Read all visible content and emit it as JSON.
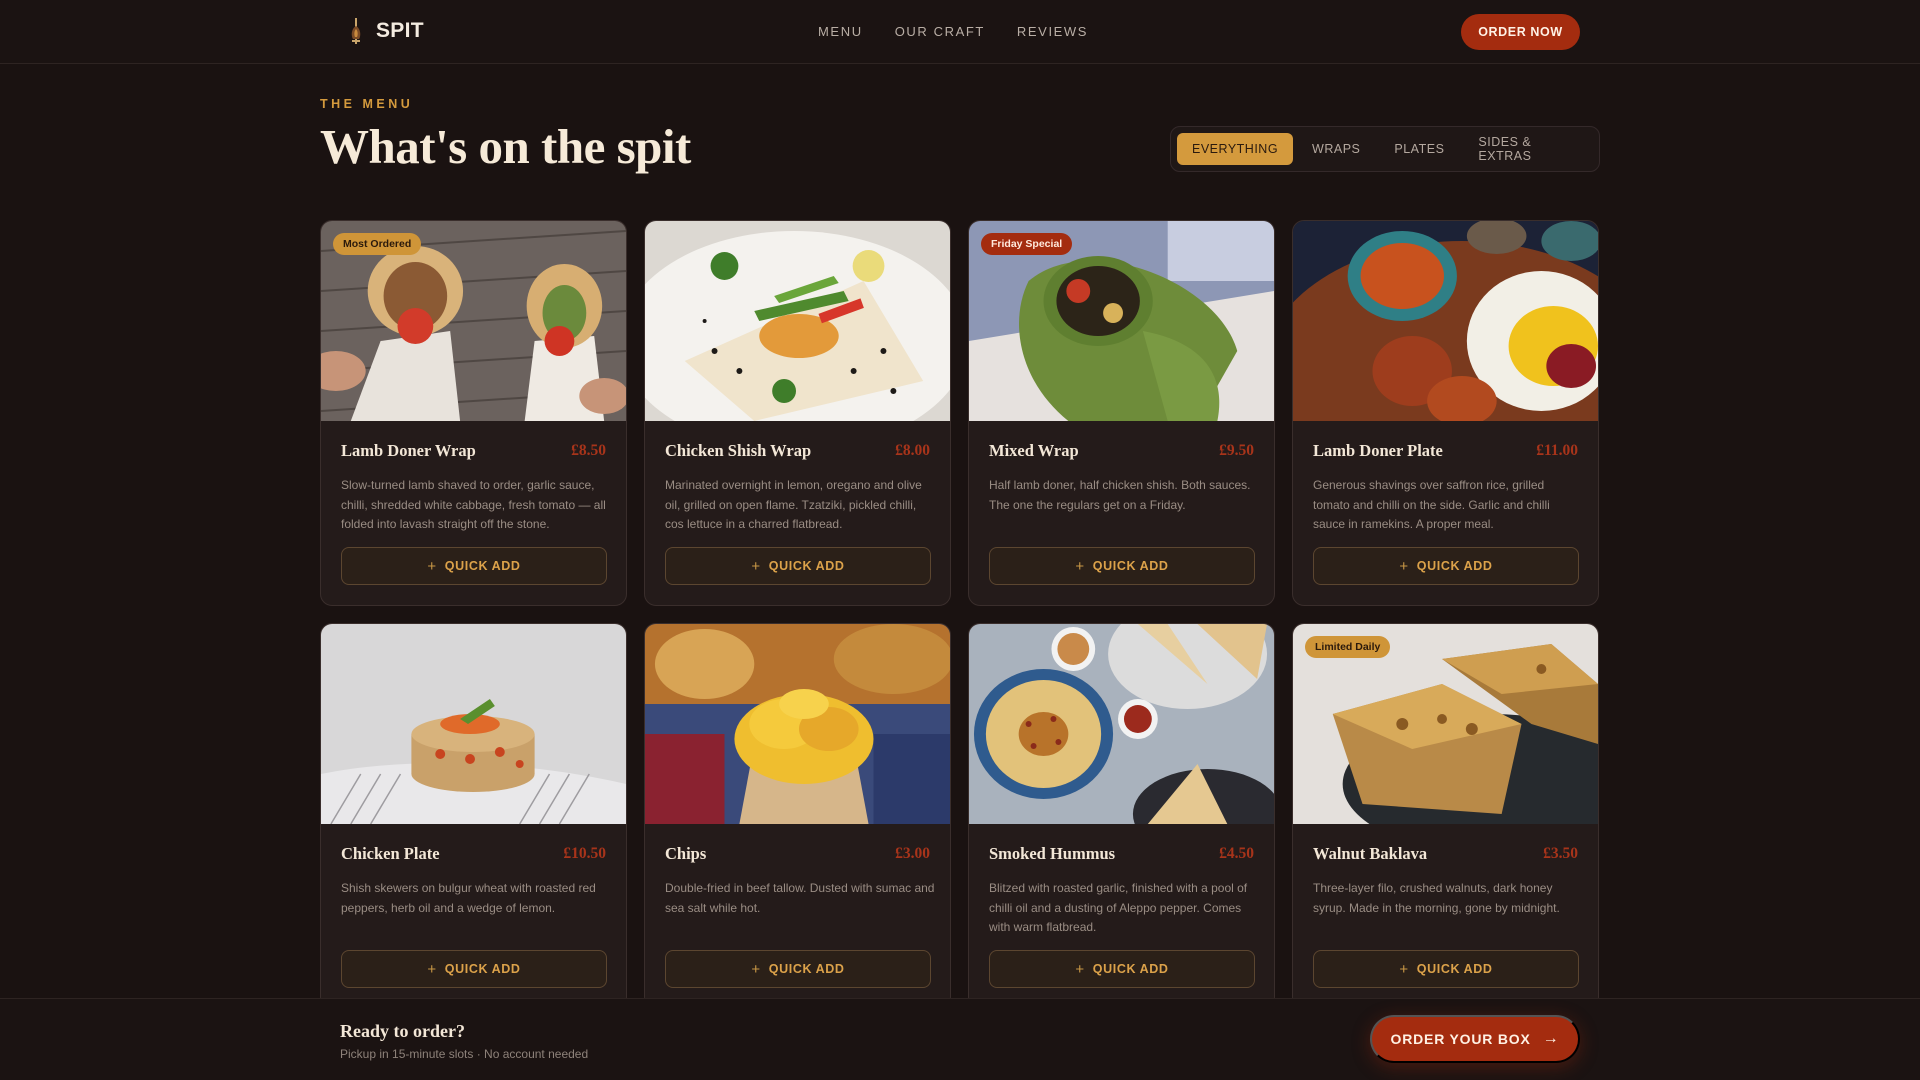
{
  "brand": {
    "name": "SPIT",
    "icon": "flame-spit-icon"
  },
  "nav": [
    "MENU",
    "OUR CRAFT",
    "REVIEWS"
  ],
  "header_cta": "ORDER NOW",
  "section": {
    "eyebrow": "THE MENU",
    "title": "What's on the spit"
  },
  "filters": {
    "items": [
      "EVERYTHING",
      "WRAPS",
      "PLATES",
      "SIDES & EXTRAS"
    ],
    "active": "EVERYTHING"
  },
  "quick_add_label": "QUICK ADD",
  "cards": [
    {
      "name": "Lamb Doner Wrap",
      "price": "£8.50",
      "badge": "Most Ordered",
      "badge_color": "gold",
      "image": "lamb-doner-wrap-photo",
      "desc": "Slow-turned lamb shaved to order, garlic sauce, chilli, shredded white cabbage, fresh tomato — all folded into lavash straight off the stone."
    },
    {
      "name": "Chicken Shish Wrap",
      "price": "£8.00",
      "badge": "",
      "badge_color": "",
      "image": "chicken-shish-wrap-photo",
      "desc": "Marinated overnight in lemon, oregano and olive oil, grilled on open flame. Tzatziki, pickled chilli, cos lettuce in a charred flatbread."
    },
    {
      "name": "Mixed Wrap",
      "price": "£9.50",
      "badge": "Friday Special",
      "badge_color": "red",
      "image": "mixed-wrap-photo",
      "desc": "Half lamb doner, half chicken shish. Both sauces. The one the regulars get on a Friday."
    },
    {
      "name": "Lamb Doner Plate",
      "price": "£11.00",
      "badge": "",
      "badge_color": "",
      "image": "lamb-doner-plate-photo",
      "desc": "Generous shavings over saffron rice, grilled tomato and chilli on the side. Garlic and chilli sauce in ramekins. A proper meal."
    },
    {
      "name": "Chicken Plate",
      "price": "£10.50",
      "badge": "",
      "badge_color": "",
      "image": "chicken-plate-photo",
      "desc": "Shish skewers on bulgur wheat with roasted red peppers, herb oil and a wedge of lemon."
    },
    {
      "name": "Chips",
      "price": "£3.00",
      "badge": "",
      "badge_color": "",
      "image": "chips-photo",
      "desc": "Double-fried in beef tallow. Dusted with sumac and sea salt while hot."
    },
    {
      "name": "Smoked Hummus",
      "price": "£4.50",
      "badge": "",
      "badge_color": "",
      "image": "smoked-hummus-photo",
      "desc": "Blitzed with roasted garlic, finished with a pool of chilli oil and a dusting of Aleppo pepper. Comes with warm flatbread."
    },
    {
      "name": "Walnut Baklava",
      "price": "£3.50",
      "badge": "Limited Daily",
      "badge_color": "gold",
      "image": "walnut-baklava-photo",
      "desc": "Three-layer filo, crushed walnuts, dark honey syrup. Made in the morning, gone by midnight."
    }
  ],
  "order_bar": {
    "title": "Ready to order?",
    "subtitle": "Pickup in 15-minute slots · No account needed",
    "cta": "ORDER YOUR BOX"
  },
  "colors": {
    "background": "#1a1211",
    "accent_red": "#a42c0f",
    "accent_gold": "#d49a3d"
  }
}
